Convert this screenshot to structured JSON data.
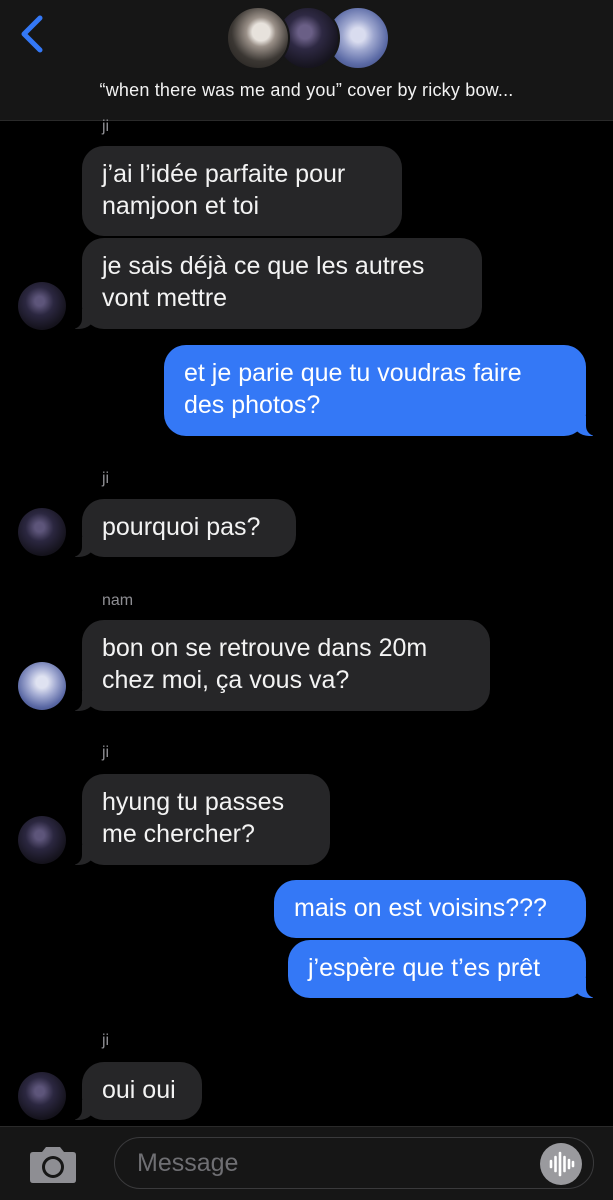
{
  "header": {
    "back_icon": "chevron-left-icon",
    "accent_color": "#3478f6",
    "title": "“when there was me and you” cover by ricky bow..."
  },
  "messages": [
    {
      "sender": "ji",
      "direction": "received",
      "text": "j’ai l’idée parfaite pour\nnamjoon et toi"
    },
    {
      "sender": "",
      "direction": "received",
      "text": "je sais déjà ce que les autres\nvont mettre"
    },
    {
      "sender": "",
      "direction": "sent",
      "text": "et je parie que tu voudras faire\ndes photos?"
    },
    {
      "sender": "ji",
      "direction": "received",
      "text": "pourquoi pas?"
    },
    {
      "sender": "nam",
      "direction": "received",
      "text": "bon on se retrouve dans 20m\nchez moi, ça vous va?"
    },
    {
      "sender": "ji",
      "direction": "received",
      "text": "hyung tu passes\nme chercher?"
    },
    {
      "sender": "",
      "direction": "sent",
      "text": "mais on est voisins???"
    },
    {
      "sender": "",
      "direction": "sent",
      "text": "j’espère que t’es prêt"
    },
    {
      "sender": "ji",
      "direction": "received",
      "text": "oui oui"
    }
  ],
  "composer": {
    "camera_icon": "camera-icon",
    "placeholder": "Message",
    "audio_icon": "audio-waveform-icon"
  },
  "colors": {
    "received_bubble": "#262628",
    "sent_bubble": "#3478f6",
    "background": "#000000",
    "bar": "#161616"
  }
}
